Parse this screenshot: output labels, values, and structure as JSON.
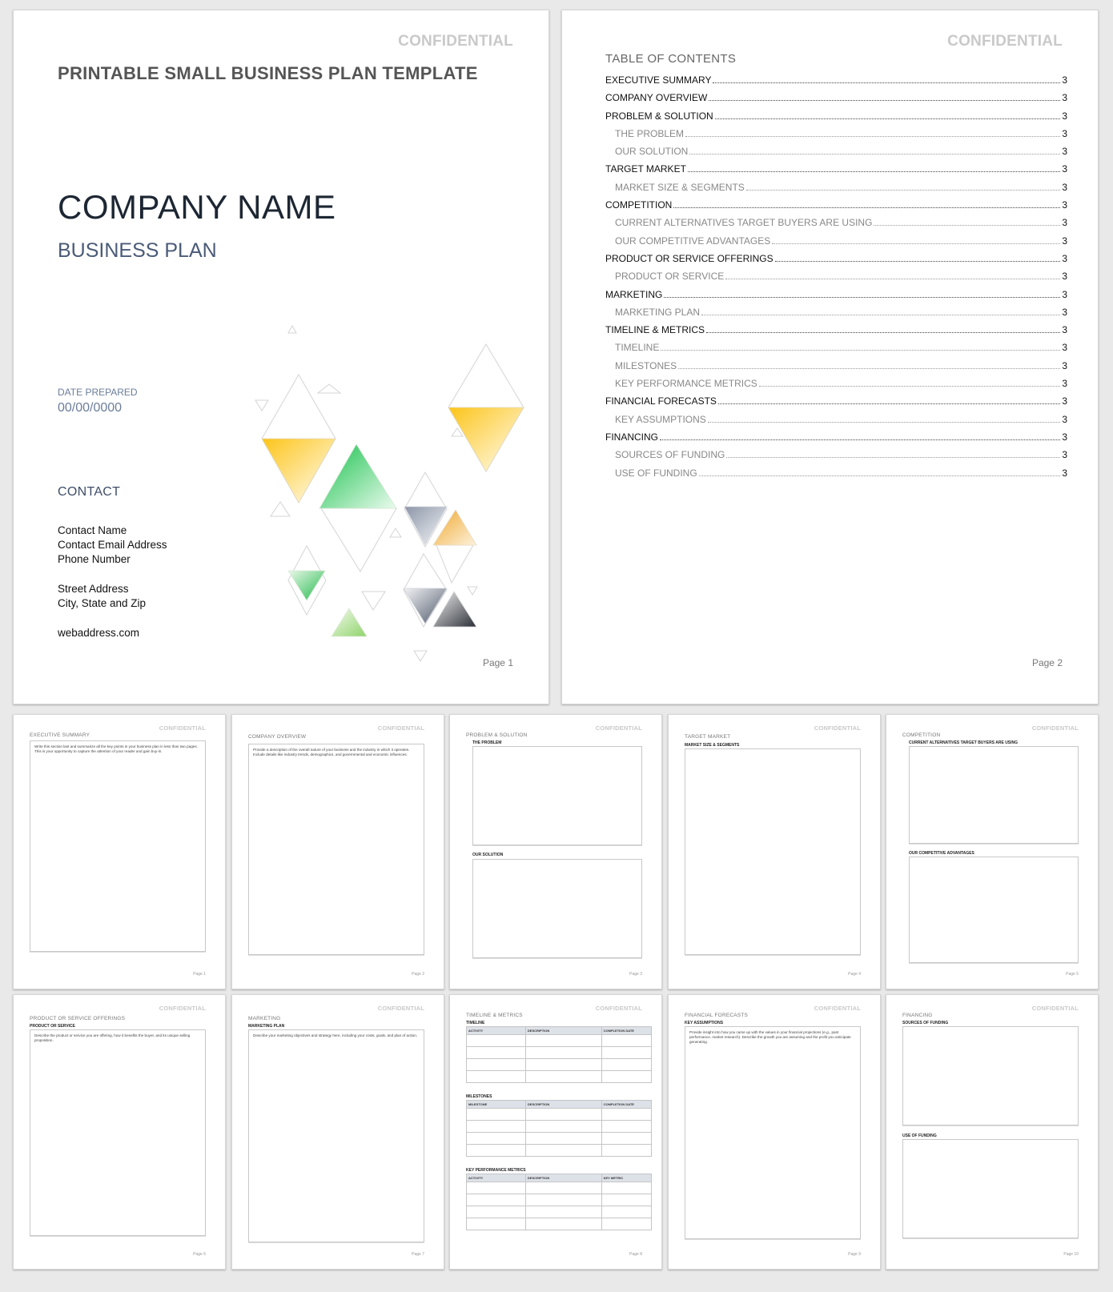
{
  "confidential_label": "CONFIDENTIAL",
  "cover": {
    "template_title": "PRINTABLE SMALL BUSINESS PLAN TEMPLATE",
    "company_name": "COMPANY NAME",
    "subtitle": "BUSINESS PLAN",
    "date_label": "DATE PREPARED",
    "date_value": "00/00/0000",
    "contact_heading": "CONTACT",
    "contact_lines": [
      "Contact Name",
      "Contact Email Address",
      "Phone Number",
      "Street Address",
      "City, State and Zip",
      "webaddress.com"
    ],
    "page_number": "Page 1",
    "art_colors": {
      "gold": "#fcc419",
      "green": "#22c55e",
      "slate": "#5a6478",
      "charcoal": "#2b2f36"
    }
  },
  "toc": {
    "heading": "TABLE OF CONTENTS",
    "entries": [
      {
        "label": "EXECUTIVE SUMMARY",
        "page": "3",
        "level": 1
      },
      {
        "label": "COMPANY OVERVIEW",
        "page": "3",
        "level": 1
      },
      {
        "label": "PROBLEM & SOLUTION",
        "page": "3",
        "level": 1
      },
      {
        "label": "THE PROBLEM",
        "page": "3",
        "level": 2
      },
      {
        "label": "OUR SOLUTION",
        "page": "3",
        "level": 2
      },
      {
        "label": "TARGET MARKET",
        "page": "3",
        "level": 1
      },
      {
        "label": "MARKET SIZE & SEGMENTS",
        "page": "3",
        "level": 2
      },
      {
        "label": "COMPETITION",
        "page": "3",
        "level": 1
      },
      {
        "label": "CURRENT ALTERNATIVES TARGET BUYERS ARE USING",
        "page": "3",
        "level": 2
      },
      {
        "label": "OUR COMPETITIVE ADVANTAGES",
        "page": "3",
        "level": 2
      },
      {
        "label": "PRODUCT OR SERVICE OFFERINGS",
        "page": "3",
        "level": 1
      },
      {
        "label": "PRODUCT OR SERVICE",
        "page": "3",
        "level": 2
      },
      {
        "label": "MARKETING",
        "page": "3",
        "level": 1
      },
      {
        "label": "MARKETING PLAN",
        "page": "3",
        "level": 2
      },
      {
        "label": "TIMELINE & METRICS",
        "page": "3",
        "level": 1
      },
      {
        "label": "TIMELINE",
        "page": "3",
        "level": 2
      },
      {
        "label": "MILESTONES",
        "page": "3",
        "level": 2
      },
      {
        "label": "KEY PERFORMANCE METRICS",
        "page": "3",
        "level": 2
      },
      {
        "label": "FINANCIAL FORECASTS",
        "page": "3",
        "level": 1
      },
      {
        "label": "KEY ASSUMPTIONS",
        "page": "3",
        "level": 2
      },
      {
        "label": "FINANCING",
        "page": "3",
        "level": 1
      },
      {
        "label": "SOURCES OF FUNDING",
        "page": "3",
        "level": 2
      },
      {
        "label": "USE OF FUNDING",
        "page": "3",
        "level": 2
      }
    ],
    "page_number": "Page 2"
  },
  "thumbnails": [
    {
      "section": "EXECUTIVE SUMMARY",
      "hint": "Write this section last and summarize all the key points in your business plan in less than two pages. This is your opportunity to capture the attention of your reader and gain buy-in.",
      "page_number": "Page 1"
    },
    {
      "section": "COMPANY OVERVIEW",
      "hint": "Provide a description of the overall nature of your business and the industry in which it operates. Include details like industry trends, demographics, and governmental and economic influences.",
      "page_number": "Page 2"
    },
    {
      "section": "PROBLEM & SOLUTION",
      "subsections": [
        "THE PROBLEM",
        "OUR SOLUTION"
      ],
      "page_number": "Page 3"
    },
    {
      "section": "TARGET MARKET",
      "subsections": [
        "MARKET SIZE & SEGMENTS"
      ],
      "page_number": "Page 4"
    },
    {
      "section": "COMPETITION",
      "subsections": [
        "CURRENT ALTERNATIVES TARGET BUYERS ARE USING",
        "OUR COMPETITIVE ADVANTAGES"
      ],
      "page_number": "Page 5"
    },
    {
      "section": "PRODUCT OR SERVICE OFFERINGS",
      "subsections": [
        "PRODUCT OR SERVICE"
      ],
      "hint": "Describe the product or service you are offering, how it benefits the buyer, and its unique selling proposition.",
      "page_number": "Page 6"
    },
    {
      "section": "MARKETING",
      "subsections": [
        "MARKETING PLAN"
      ],
      "hint": "Describe your marketing objectives and strategy here, including your costs, goals, and plan of action.",
      "page_number": "Page 7"
    },
    {
      "section": "TIMELINE & METRICS",
      "tables": [
        {
          "title": "TIMELINE",
          "columns": [
            "ACTIVITY",
            "DESCRIPTION",
            "COMPLETION DATE"
          ]
        },
        {
          "title": "MILESTONES",
          "columns": [
            "MILESTONE",
            "DESCRIPTION",
            "COMPLETION DATE"
          ]
        },
        {
          "title": "KEY PERFORMANCE METRICS",
          "columns": [
            "ACTIVITY",
            "DESCRIPTION",
            "KEY METRIC"
          ]
        }
      ],
      "page_number": "Page 8"
    },
    {
      "section": "FINANCIAL FORECASTS",
      "subsections": [
        "KEY ASSUMPTIONS"
      ],
      "hint": "Provide insight into how you came up with the values in your financial projections (e.g., past performance, market research). Describe the growth you are assuming and the profit you anticipate generating.",
      "page_number": "Page 9"
    },
    {
      "section": "FINANCING",
      "subsections": [
        "SOURCES OF FUNDING",
        "USE OF FUNDING"
      ],
      "page_number": "Page 10"
    }
  ]
}
